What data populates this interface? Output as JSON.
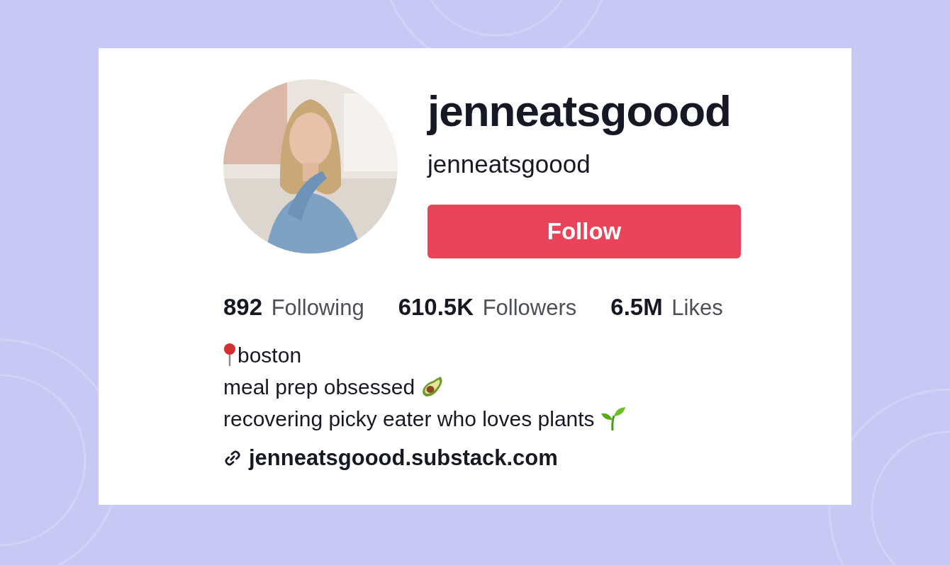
{
  "profile": {
    "display_name": "jenneatsgoood",
    "username": "jenneatsgoood"
  },
  "follow_button": {
    "label": "Follow"
  },
  "stats": [
    {
      "text": "**892** Following"
    },
    {
      "text": "**610.5K** Followers"
    },
    {
      "text": "**6.5M** Likes"
    }
  ],
  "bio": [
    {
      "text": "boston",
      "kind": "location"
    },
    {
      "text": "meal prep obsessed",
      "kind": "food"
    },
    {
      "text": "recovering picky eater who loves plants",
      "kind": "plant"
    }
  ],
  "link": {
    "text": "jenneatsgoood.substack.com"
  }
}
